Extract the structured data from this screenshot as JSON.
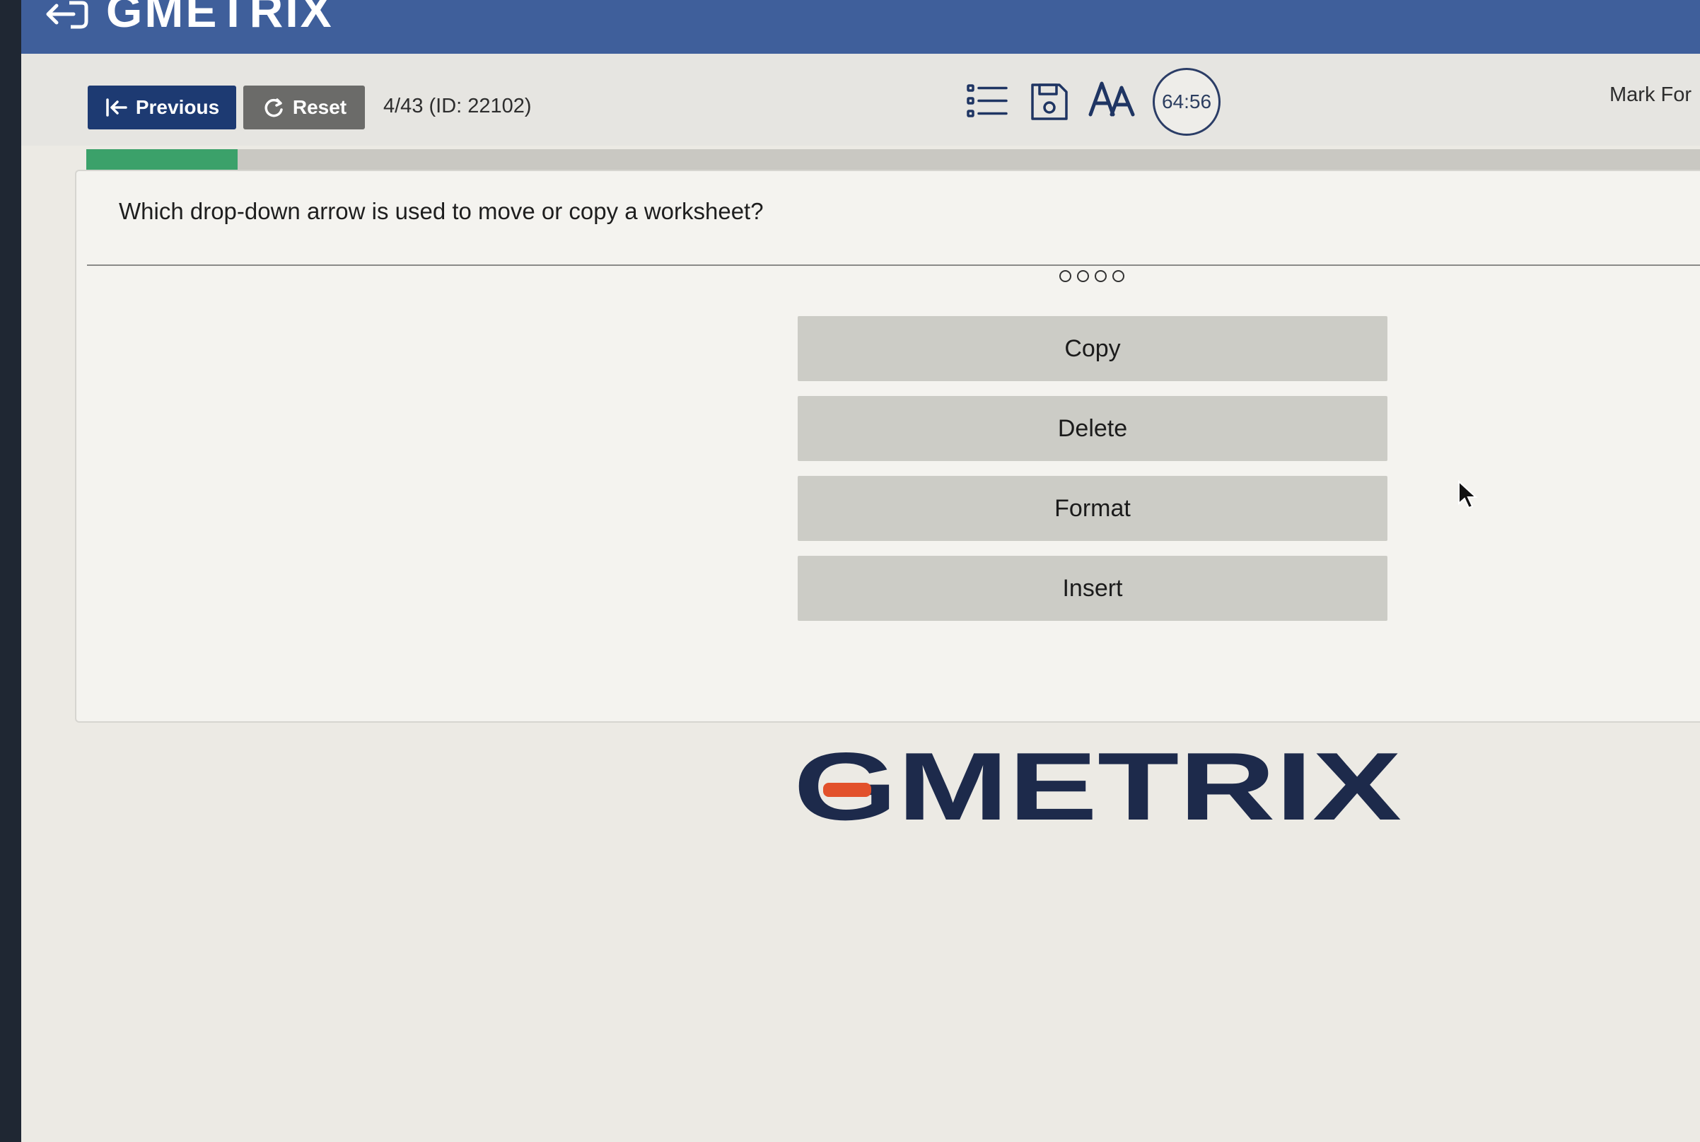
{
  "brand": {
    "name": "GMETRIX",
    "colors": {
      "navy": "#1d3a72",
      "header_blue": "#3f5f9b",
      "accent_orange": "#e2512b",
      "progress_green": "#3ba16a"
    }
  },
  "toolbar": {
    "previous_label": "Previous",
    "reset_label": "Reset",
    "question_position": "4/43 (ID: 22102)",
    "timer": "64:56",
    "mark_label": "Mark For",
    "icons": [
      "list-icon",
      "save-icon",
      "font-size-icon"
    ]
  },
  "progress": {
    "fraction": 0.093
  },
  "question": {
    "text": "Which drop-down arrow is used to move or copy a worksheet?",
    "answers": [
      "Copy",
      "Delete",
      "Format",
      "Insert"
    ]
  }
}
